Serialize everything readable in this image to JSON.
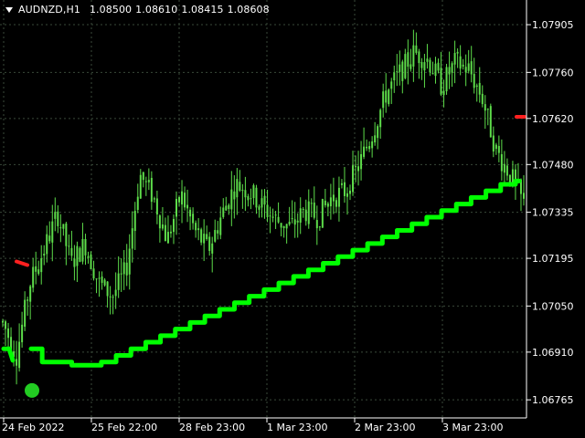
{
  "header": {
    "symbol": "AUDNZD,H1",
    "open": "1.08500",
    "high": "1.08610",
    "low": "1.08415",
    "close": "1.08608"
  },
  "colors": {
    "background": "#000000",
    "candles": "#5ddc4a",
    "indicator": "#00ff00",
    "marker_red": "#ff2020",
    "signal_dot": "#22cc22",
    "grid": "#3a4a3a",
    "axis_text": "#ffffff"
  },
  "chart_data": {
    "type": "line",
    "title": "",
    "y_ticks": [
      "1.07905",
      "1.07760",
      "1.07620",
      "1.07480",
      "1.07335",
      "1.07195",
      "1.07050",
      "1.06910",
      "1.06765"
    ],
    "x_ticks": [
      "24 Feb 2022",
      "25 Feb 22:00",
      "28 Feb 23:00",
      "1 Mar 23:00",
      "2 Mar 23:00",
      "3 Mar 23:00"
    ],
    "ylim": [
      1.0671,
      1.0798
    ],
    "price_path": [
      1.07,
      1.069,
      1.0712,
      1.0722,
      1.0733,
      1.0718,
      1.0724,
      1.0712,
      1.0708,
      1.0716,
      1.0745,
      1.0738,
      1.0725,
      1.0739,
      1.0728,
      1.0722,
      1.0733,
      1.0742,
      1.074,
      1.0735,
      1.0731,
      1.0729,
      1.0734,
      1.0732,
      1.0738,
      1.074,
      1.0748,
      1.0758,
      1.077,
      1.0776,
      1.0782,
      1.078,
      1.0772,
      1.0779,
      1.0777,
      1.0768,
      1.0752,
      1.0745,
      1.0736
    ],
    "series": [
      {
        "values": [
          1.0692,
          1.0688,
          1.0688,
          1.0687,
          1.0687,
          1.0688,
          1.069,
          1.0692,
          1.0694,
          1.0696,
          1.0698,
          1.07,
          1.0702,
          1.0704,
          1.0706,
          1.0708,
          1.071,
          1.0712,
          1.0714,
          1.0716,
          1.0718,
          1.072,
          1.0722,
          1.0724,
          1.0726,
          1.0728,
          1.073,
          1.0732,
          1.0734,
          1.0736,
          1.0738,
          1.074,
          1.0742,
          1.0743
        ]
      }
    ],
    "markers": [
      {
        "type": "red-dash",
        "price": 1.0718
      },
      {
        "type": "red-dash",
        "price": 1.07625
      },
      {
        "type": "signal-dot",
        "price": 1.0686
      }
    ]
  }
}
